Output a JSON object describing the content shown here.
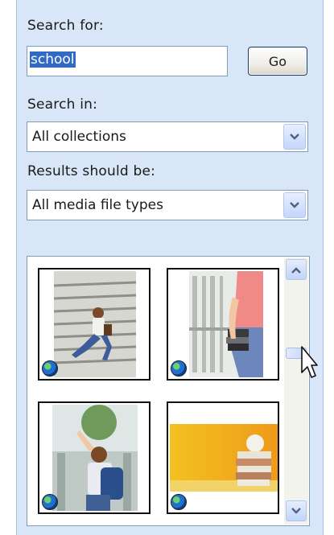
{
  "search": {
    "label": "Search for:",
    "query": "school",
    "go_label": "Go"
  },
  "search_in": {
    "label": "Search in:",
    "selected": "All collections"
  },
  "results_type": {
    "label": "Results should be:",
    "selected": "All media file types"
  },
  "results": {
    "items": [
      {
        "icon": "student-on-stairs-photo"
      },
      {
        "icon": "student-holding-books-photo"
      },
      {
        "icon": "student-with-backpack-photo"
      },
      {
        "icon": "stacked-books-with-apple-photo"
      }
    ],
    "scrollbar": {
      "up_icon": "chevron-up-icon",
      "down_icon": "chevron-down-icon"
    }
  },
  "colors": {
    "pane_background": "#d9e6f8",
    "selection": "#316ac5",
    "field_border": "#7f9db9"
  }
}
